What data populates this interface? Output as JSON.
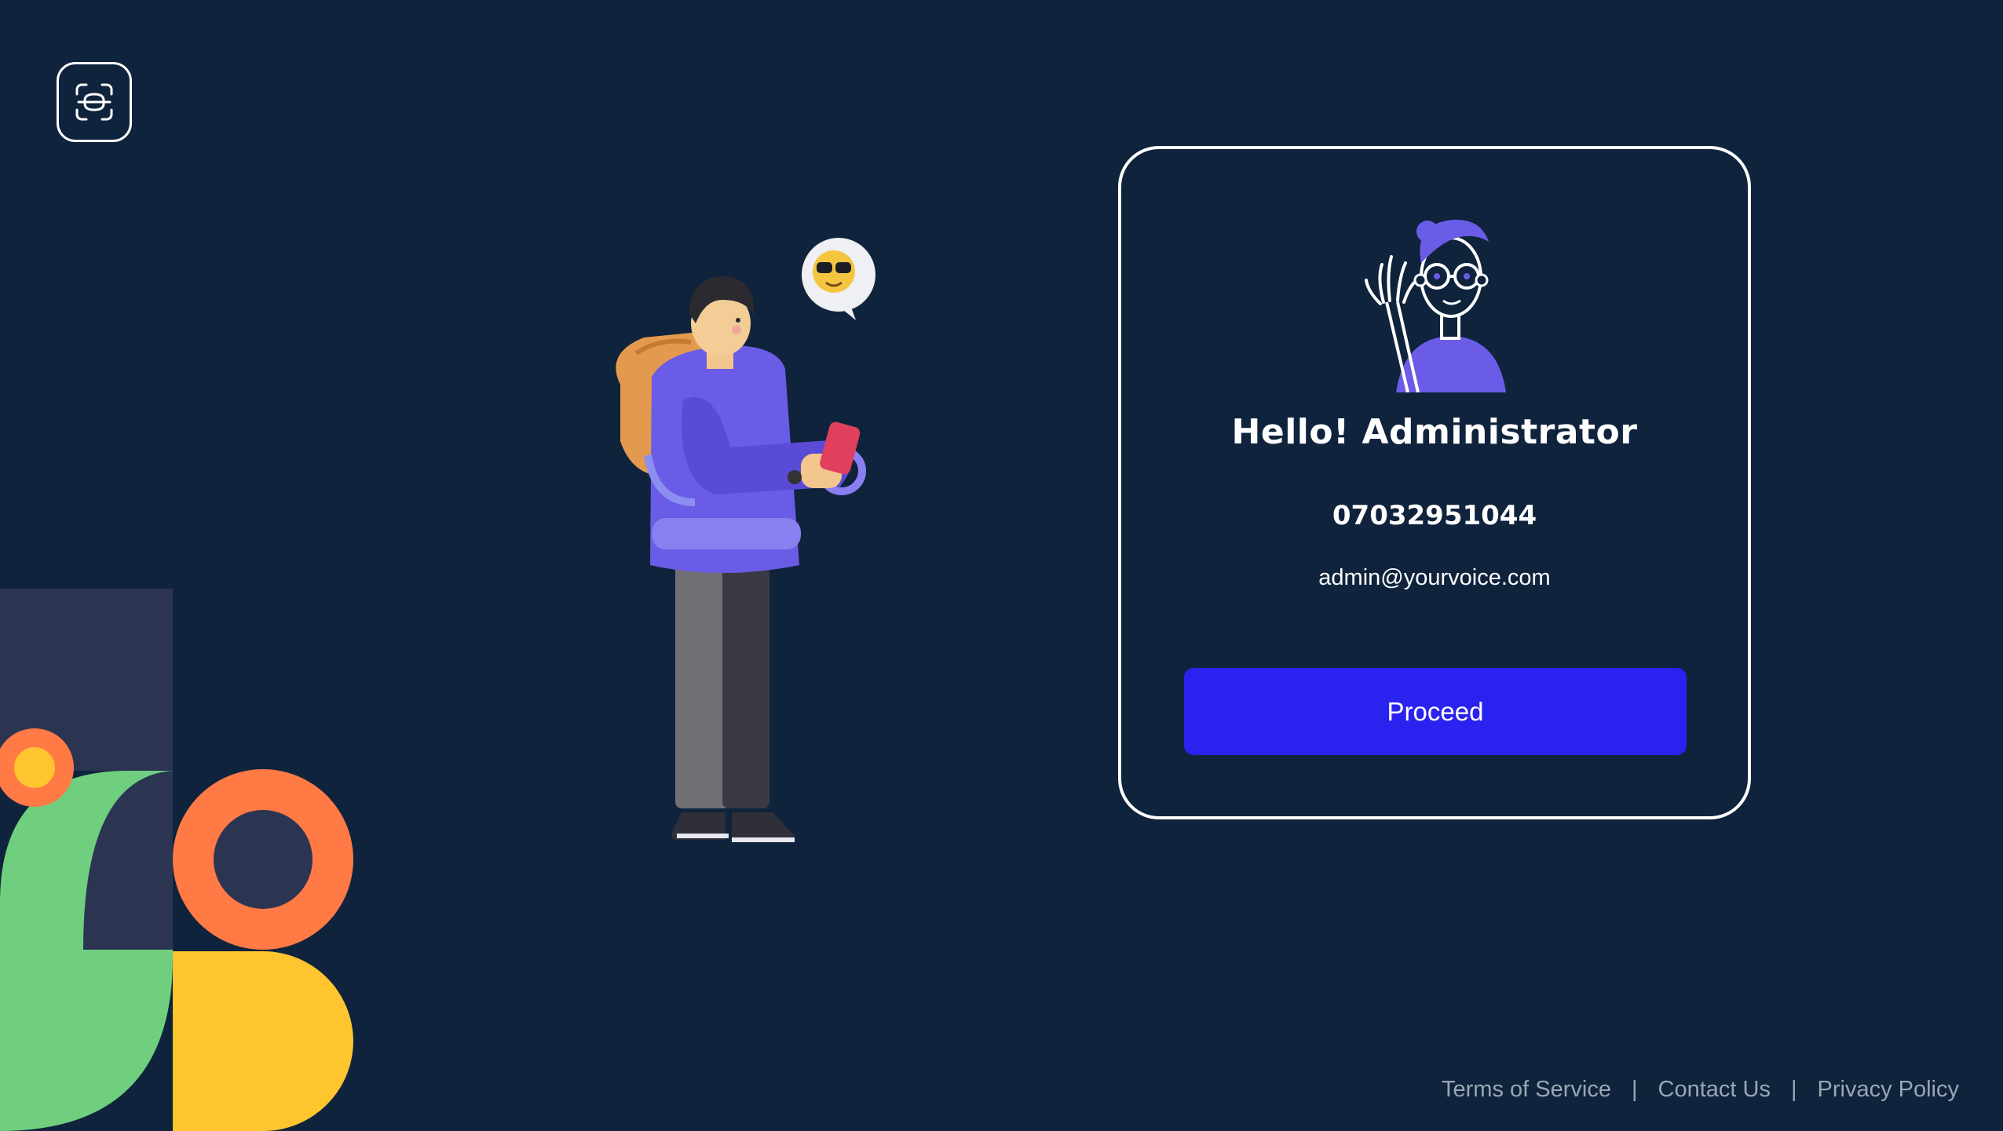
{
  "profile": {
    "greeting": "Hello! Administrator",
    "phone": "07032951044",
    "email": "admin@yourvoice.com"
  },
  "actions": {
    "proceed_label": "Proceed"
  },
  "footer": {
    "links": [
      "Terms of Service",
      "Contact Us",
      "Privacy Policy"
    ],
    "separator": "|"
  },
  "icons": {
    "logo": "face-scan-icon",
    "illustration": "person-with-phone-illustration",
    "avatar": "waving-man-avatar",
    "emoji": "sunglasses-emoji"
  },
  "colors": {
    "background": "#0f233c",
    "button": "#2a22ee",
    "card_border": "#ffffff",
    "footer_text": "#9aa6b5",
    "shape_orange": "#ff7a45",
    "shape_green": "#6fcf7f",
    "shape_yellow": "#ffc52e",
    "shape_slate": "#2b3552"
  }
}
